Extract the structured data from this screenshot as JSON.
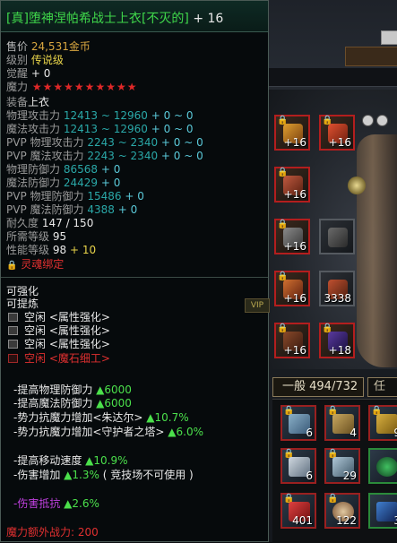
{
  "item": {
    "prefix": "[真]",
    "name": "堕神涅帕希战士上衣",
    "suffix": "[不灭的]",
    "enhance": "+ 16"
  },
  "rows": {
    "price_label": "售价",
    "price_value": "24,531",
    "price_unit": "金币",
    "grade_label": "级别",
    "grade_value": "传说级",
    "awaken_label": "觉醒",
    "awaken_value": "+ 0",
    "magic_label": "魔力",
    "equip_label": "装备",
    "equip_value": "上衣",
    "phys_atk_label": "物理攻击力",
    "phys_atk_value": "12413 ~ 12960",
    "phys_atk_bonus": "+ 0 ~ 0",
    "mag_atk_label": "魔法攻击力",
    "mag_atk_value": "12413 ~ 12960",
    "mag_atk_bonus": "+ 0 ~ 0",
    "pvp_phys_atk_label": "PVP 物理攻击力",
    "pvp_phys_atk_value": "2243 ~ 2340",
    "pvp_phys_atk_bonus": "+ 0 ~ 0",
    "pvp_mag_atk_label": "PVP 魔法攻击力",
    "pvp_mag_atk_value": "2243 ~ 2340",
    "pvp_mag_atk_bonus": "+ 0 ~ 0",
    "phys_def_label": "物理防御力",
    "phys_def_value": "86568",
    "phys_def_bonus": "+ 0",
    "mag_def_label": "魔法防御力",
    "mag_def_value": "24429",
    "mag_def_bonus": "+ 0",
    "pvp_phys_def_label": "PVP 物理防御力",
    "pvp_phys_def_value": "15486",
    "pvp_phys_def_bonus": "+ 0",
    "pvp_mag_def_label": "PVP 魔法防御力",
    "pvp_mag_def_value": "4388",
    "pvp_mag_def_bonus": "+ 0",
    "durability_label": "耐久度",
    "durability_value": "147 / 150",
    "req_level_label": "所需等级",
    "req_level_value": "95",
    "perf_level_label": "性能等级",
    "perf_level_value": "98",
    "perf_level_bonus": "+ 10",
    "soul_bind": "灵魂绑定"
  },
  "stars": [
    "★",
    "★",
    "★",
    "★",
    "★",
    "★",
    "★",
    "★",
    "★",
    "★"
  ],
  "enhance": {
    "can_enhance": "可强化",
    "can_refine": "可提炼",
    "sockets": [
      {
        "text": "空闲 <属性强化>",
        "type": "normal"
      },
      {
        "text": "空闲 <属性强化>",
        "type": "normal"
      },
      {
        "text": "空闲 <属性强化>",
        "type": "normal"
      },
      {
        "text": "空闲 <魔石细工>",
        "type": "red"
      }
    ]
  },
  "effects": {
    "e1_label": "-提高物理防御力",
    "e1_value": "▲6000",
    "e2_label": "-提高魔法防御力",
    "e2_value": "▲6000",
    "e3_label": "-势力抗魔力增加<朱达尔>",
    "e3_value": "▲10.7%",
    "e4_label": "-势力抗魔力增加<守护者之塔>",
    "e4_value": "▲6.0%",
    "e5_label": "-提高移动速度",
    "e5_value": "▲10.9%",
    "e6_label": "-伤害增加",
    "e6_value": "▲1.3%",
    "e6_note": "( 竞技场不可使用 )",
    "e7_label": "-伤害抵抗",
    "e7_value": "▲2.6%",
    "extra_label": "魔力额外战力:",
    "extra_value": "200"
  },
  "equip_slots": [
    {
      "num": "+16"
    },
    {
      "num": "+16"
    },
    {
      "num": "+16"
    },
    {
      "num": "+16"
    },
    {
      "num": "+16"
    },
    {
      "num": "3338"
    },
    {
      "num": "+16"
    },
    {
      "num": "+18"
    }
  ],
  "inventory": {
    "tab_label": "一般 494/732",
    "tab2_label": "任",
    "items": [
      {
        "num": "6"
      },
      {
        "num": "4"
      },
      {
        "num": "9"
      },
      {
        "num": "6"
      },
      {
        "num": "29"
      },
      {
        "num": ""
      },
      {
        "num": "401"
      },
      {
        "num": "122"
      },
      {
        "num": "3"
      }
    ]
  },
  "colors": {
    "title_green": "#3fd64a",
    "gold": "#d8a640",
    "teal": "#2aa8a8",
    "green_value": "#4be04b",
    "red": "#e03030",
    "magenta": "#c040e0"
  },
  "icons": {
    "lock": "padlock-icon",
    "socket": "socket-icon"
  }
}
